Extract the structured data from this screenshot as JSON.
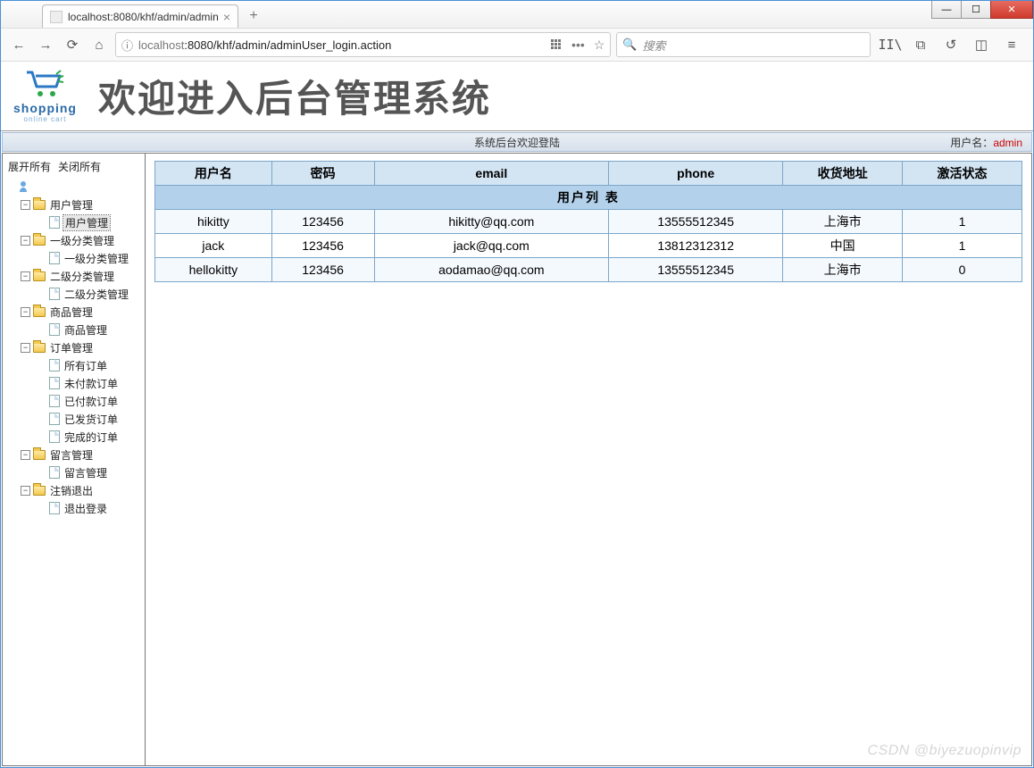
{
  "browser": {
    "tab_title": "localhost:8080/khf/admin/admin",
    "url_host": "localhost",
    "url_path": ":8080/khf/admin/adminUser_login.action",
    "search_placeholder": "搜索"
  },
  "header": {
    "logo_text": "shopping",
    "logo_sub": "online cart",
    "title": "欢迎进入后台管理系统"
  },
  "welcome_bar": {
    "center": "系统后台欢迎登陆",
    "user_label": "用户名：",
    "user_name": "admin"
  },
  "sidebar": {
    "expand_all": "展开所有",
    "collapse_all": "关闭所有",
    "tree": [
      {
        "label": "用户管理",
        "children": [
          {
            "label": "用户管理",
            "selected": true
          }
        ]
      },
      {
        "label": "一级分类管理",
        "children": [
          {
            "label": "一级分类管理"
          }
        ]
      },
      {
        "label": "二级分类管理",
        "children": [
          {
            "label": "二级分类管理"
          }
        ]
      },
      {
        "label": "商品管理",
        "children": [
          {
            "label": "商品管理"
          }
        ]
      },
      {
        "label": "订单管理",
        "children": [
          {
            "label": "所有订单"
          },
          {
            "label": "未付款订单"
          },
          {
            "label": "已付款订单"
          },
          {
            "label": "已发货订单"
          },
          {
            "label": "完成的订单"
          }
        ]
      },
      {
        "label": "留言管理",
        "children": [
          {
            "label": "留言管理"
          }
        ]
      },
      {
        "label": "注销退出",
        "children": [
          {
            "label": "退出登录"
          }
        ]
      }
    ]
  },
  "table": {
    "title": "用户列 表",
    "columns": [
      "用户名",
      "密码",
      "email",
      "phone",
      "收货地址",
      "激活状态"
    ],
    "rows": [
      [
        "hikitty",
        "123456",
        "hikitty@qq.com",
        "13555512345",
        "上海市",
        "1"
      ],
      [
        "jack",
        "123456",
        "jack@qq.com",
        "13812312312",
        "中国",
        "1"
      ],
      [
        "hellokitty",
        "123456",
        "aodamao@qq.com",
        "13555512345",
        "上海市",
        "0"
      ]
    ]
  },
  "watermark": "CSDN @biyezuopinvip"
}
